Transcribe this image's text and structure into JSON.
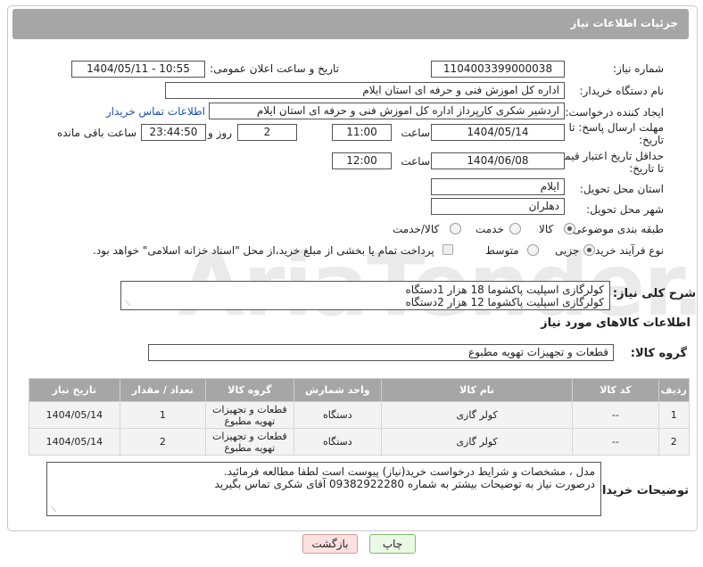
{
  "header": {
    "title": "جزئیات اطلاعات نیاز"
  },
  "fields": {
    "need_number": {
      "label": "شماره نیاز:",
      "value": "1104003399000038"
    },
    "announce_datetime": {
      "label": "تاریخ و ساعت اعلان عمومی:",
      "value": "1404/05/11 - 10:55"
    },
    "buyer_org": {
      "label": "نام دستگاه خریدار:",
      "value": "اداره کل اموزش فنی و حرفه ای استان ایلام"
    },
    "requester": {
      "label": "ایجاد کننده درخواست:",
      "value": "اردشیر شکری کارپرداز اداره کل اموزش فنی و حرفه ای استان ایلام",
      "link": "اطلاعات تماس خریدار"
    },
    "reply_deadline": {
      "label_line1": "مهلت ارسال پاسخ: تا",
      "label_line2": "تاریخ:",
      "date": "1404/05/14",
      "time_label": "ساعت",
      "time": "11:00",
      "days": "2",
      "days_label": "روز و",
      "remaining": "23:44:50",
      "remaining_label": "ساعت باقی مانده"
    },
    "price_validity": {
      "label_line1": "حداقل تاریخ اعتبار قیمت:",
      "label_line2": "تا تاریخ:",
      "date": "1404/06/08",
      "time_label": "ساعت",
      "time": "12:00"
    },
    "delivery_province": {
      "label": "استان محل تحویل:",
      "value": "ایلام"
    },
    "delivery_city": {
      "label": "شهر محل تحویل:",
      "value": "دهلران"
    },
    "category": {
      "label": "طبقه بندی موضوعی:",
      "options": [
        "کالا",
        "خدمت",
        "کالا/خدمت"
      ],
      "selected": "کالا"
    },
    "process": {
      "label": "نوع فرآیند خرید :",
      "options": [
        "جزیی",
        "متوسط"
      ],
      "selected": "جزیی",
      "note": "پرداخت تمام یا بخشی از مبلغ خرید،از محل \"اسناد خزانه اسلامی\" خواهد بود."
    },
    "description": {
      "label": "شرح کلی نیاز:",
      "lines": [
        "کولرگازی اسپلیت پاکشوما 18 هزار 1دستگاه",
        "کولرگازی اسپلیت پاکشوما 12 هزار 2دستگاه"
      ]
    }
  },
  "goods_section": {
    "title": "اطلاعات کالاهای مورد نیاز",
    "group_label": "گروه کالا:",
    "group_value": "قطعات و تجهیزات تهویه مطبوع"
  },
  "goods_table": {
    "headers": [
      "ردیف",
      "کد کالا",
      "نام کالا",
      "واحد شمارش",
      "گروه کالا",
      "تعداد / مقدار",
      "تاریخ نیاز"
    ],
    "rows": [
      {
        "row": "1",
        "code": "--",
        "name": "کولر گازی",
        "unit": "دستگاه",
        "group": "قطعات و تجهیزات تهویه مطبوع",
        "qty": "1",
        "date": "1404/05/14"
      },
      {
        "row": "2",
        "code": "--",
        "name": "کولر گازی",
        "unit": "دستگاه",
        "group": "قطعات و تجهیزات تهویه مطبوع",
        "qty": "2",
        "date": "1404/05/14"
      }
    ]
  },
  "buyer_notes": {
    "label": "توضیحات خریدار:",
    "lines": [
      "مدل ، مشخصات و شرایط درخواست خرید(نیاز)  پیوست است لطفا مطالعه فرمائید.",
      "درصورت نیاز به توضیحات بیشتر به شماره 09382922280 آقای شکری تماس بگیرید"
    ]
  },
  "buttons": {
    "print": "چاپ",
    "back": "بازگشت"
  },
  "watermark": "AriaTender.neT"
}
